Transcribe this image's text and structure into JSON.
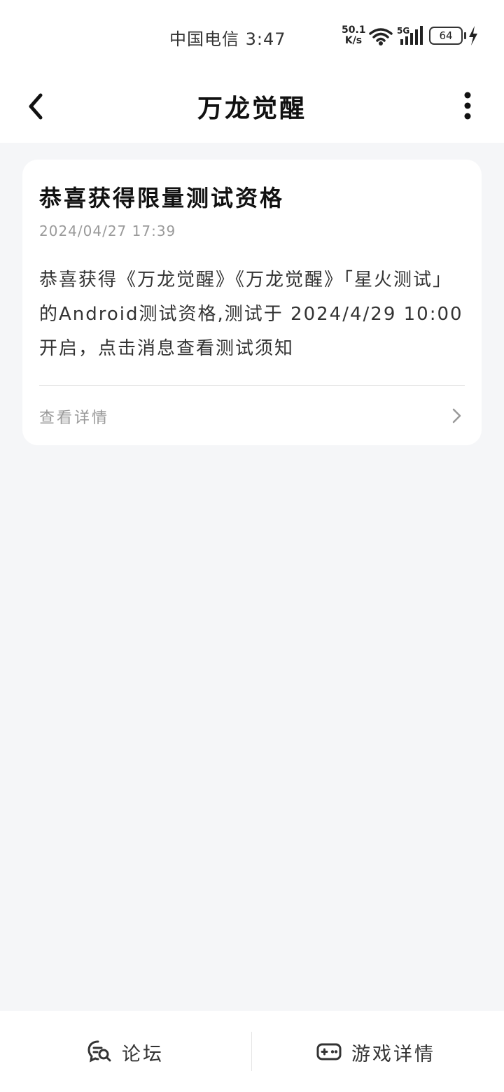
{
  "status_bar": {
    "carrier_time": "中国电信 3:47",
    "net_speed_value": "50.1",
    "net_speed_unit": "K/s",
    "network_type": "5G",
    "battery": "64"
  },
  "header": {
    "title": "万龙觉醒",
    "back_icon": "chevron-left-icon",
    "more_icon": "more-vertical-icon"
  },
  "message": {
    "title": "恭喜获得限量测试资格",
    "date": "2024/04/27 17:39",
    "body": "恭喜获得《万龙觉醒》《万龙觉醒》「星火测试」的Android测试资格,测试于 2024/4/29 10:00 开启，点击消息查看测试须知",
    "details_label": "查看详情"
  },
  "bottom_bar": {
    "forum_label": "论坛",
    "forum_icon": "forum-icon",
    "game_details_label": "游戏详情",
    "game_icon": "gamepad-icon"
  }
}
